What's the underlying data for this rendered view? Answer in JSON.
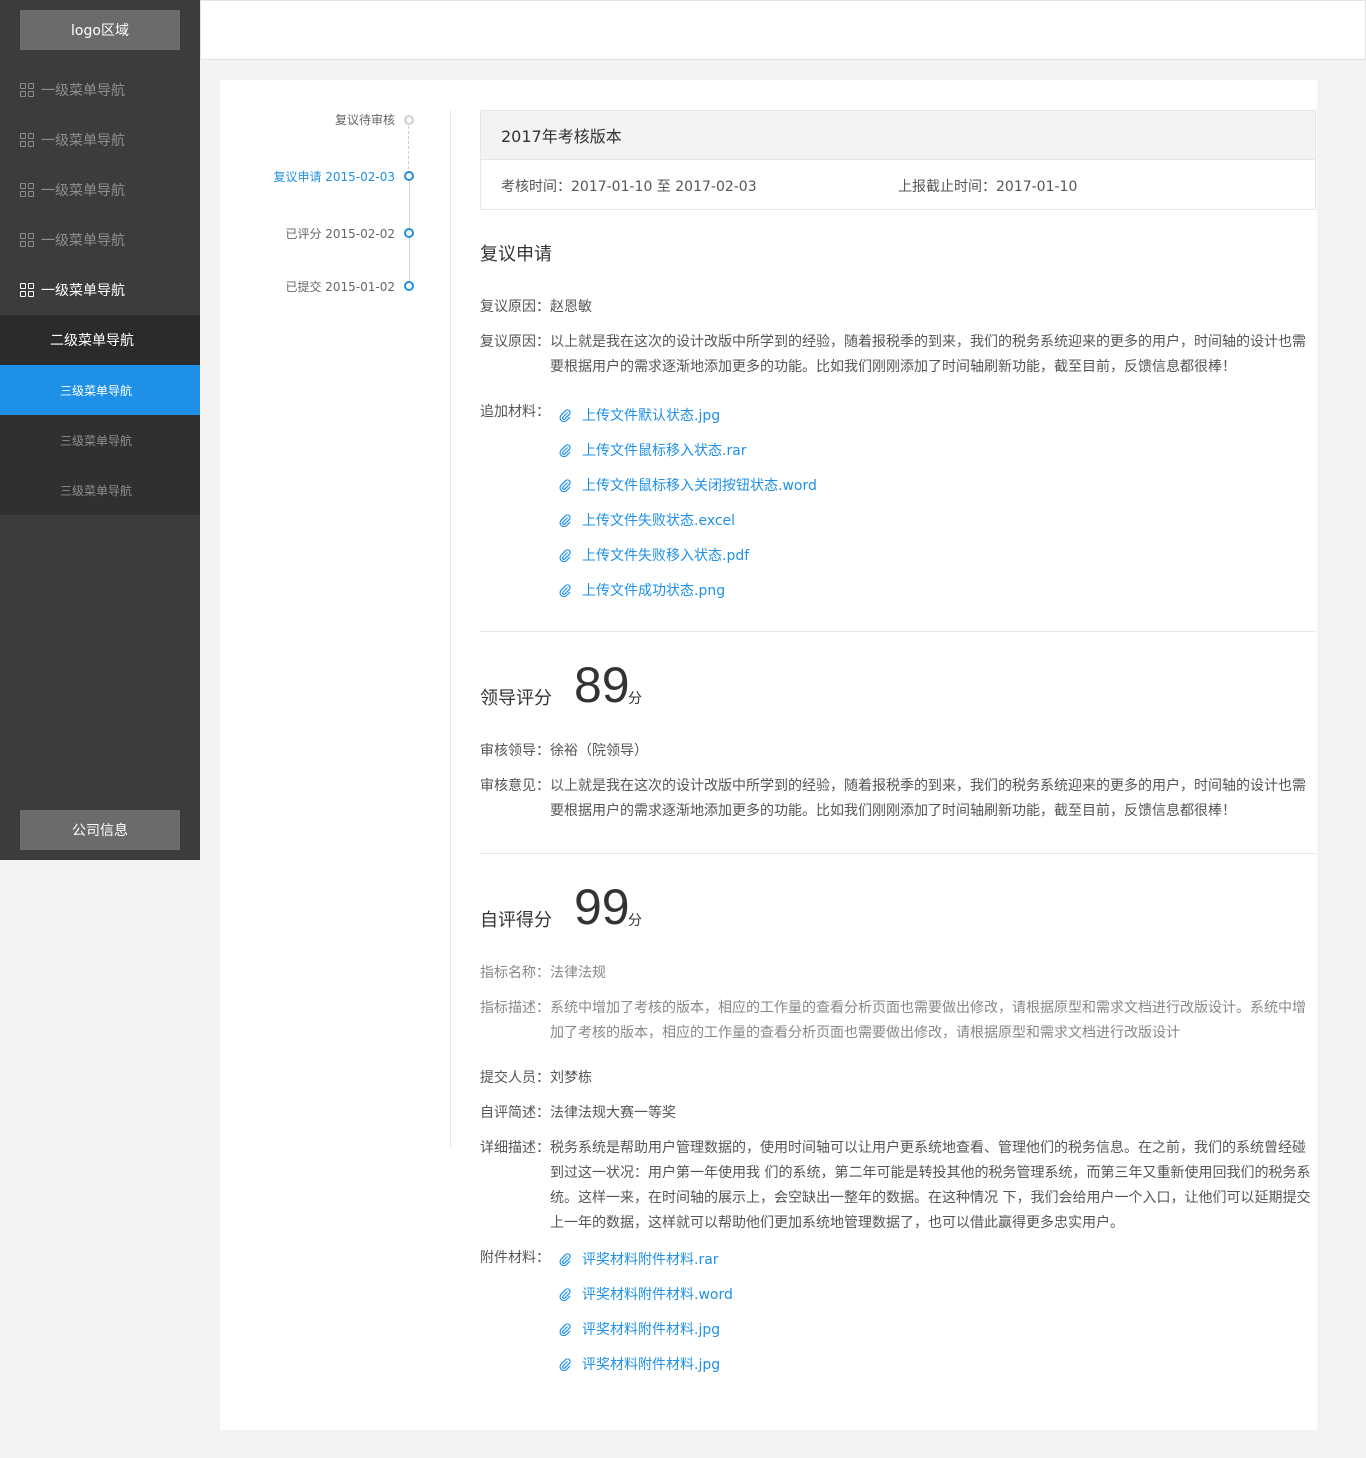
{
  "sidebar": {
    "logo": "logo区域",
    "level1": [
      "一级菜单导航",
      "一级菜单导航",
      "一级菜单导航",
      "一级菜单导航",
      "一级菜单导航"
    ],
    "level2": "二级菜单导航",
    "level3": [
      "三级菜单导航",
      "三级菜单导航",
      "三级菜单导航"
    ],
    "company": "公司信息"
  },
  "timeline": [
    {
      "text": "复议待审核",
      "state": "pending"
    },
    {
      "text": "复议申请 2015-02-03",
      "state": "current"
    },
    {
      "text": "已评分 2015-02-02",
      "state": "done"
    },
    {
      "text": "已提交 2015-01-02",
      "state": "done"
    }
  ],
  "card": {
    "title": "2017年考核版本",
    "period": "考核时间：2017-01-10 至 2017-02-03",
    "deadline": "上报截止时间：2017-01-10"
  },
  "review": {
    "title": "复议申请",
    "reason1_label": "复议原因：",
    "reason1_value": "赵恩敏",
    "reason2_label": "复议原因：",
    "reason2_value": "以上就是我在这次的设计改版中所学到的经验，随着报税季的到来，我们的税务系统迎来的更多的用户，时间轴的设计也需要根据用户的需求逐渐地添加更多的功能。比如我们刚刚添加了时间轴刷新功能，截至目前，反馈信息都很棒！",
    "materials_label": "追加材料：",
    "files": [
      "上传文件默认状态.jpg",
      "上传文件鼠标移入状态.rar",
      "上传文件鼠标移入关闭按钮状态.word",
      "上传文件失败状态.excel",
      "上传文件失败移入状态.pdf",
      "上传文件成功状态.png"
    ]
  },
  "leader": {
    "title": "领导评分",
    "score": "89",
    "unit": "分",
    "reviewer_label": "审核领导：",
    "reviewer_value": "徐裕（院领导）",
    "opinion_label": "审核意见：",
    "opinion_value": "以上就是我在这次的设计改版中所学到的经验，随着报税季的到来，我们的税务系统迎来的更多的用户，时间轴的设计也需要根据用户的需求逐渐地添加更多的功能。比如我们刚刚添加了时间轴刷新功能，截至目前，反馈信息都很棒！"
  },
  "self": {
    "title": "自评得分",
    "score": "99",
    "unit": "分",
    "index_name_label": "指标名称：",
    "index_name_value": "法律法规",
    "index_desc_label": "指标描述：",
    "index_desc_value": "系统中增加了考核的版本，相应的工作量的查看分析页面也需要做出修改，请根据原型和需求文档进行改版设计。系统中增加了考核的版本，相应的工作量的查看分析页面也需要做出修改，请根据原型和需求文档进行改版设计",
    "submitter_label": "提交人员：",
    "submitter_value": "刘梦栋",
    "summary_label": "自评简述：",
    "summary_value": "法律法规大赛一等奖",
    "detail_label": "详细描述：",
    "detail_value": "税务系统是帮助用户管理数据的，使用时间轴可以让用户更系统地查看、管理他们的税务信息。在之前，我们的系统曾经碰到过这一状况：用户第一年使用我 们的系统，第二年可能是转投其他的税务管理系统，而第三年又重新使用回我们的税务系统。这样一来，在时间轴的展示上，会空缺出一整年的数据。在这种情况 下，我们会给用户一个入口，让他们可以延期提交上一年的数据，这样就可以帮助他们更加系统地管理数据了，也可以借此赢得更多忠实用户。",
    "attach_label": "附件材料：",
    "files": [
      "评奖材料附件材料.rar",
      "评奖材料附件材料.word",
      "评奖材料附件材料.jpg",
      "评奖材料附件材料.jpg"
    ]
  },
  "colors": {
    "accent": "#1e90e8",
    "sidebar": "#3c3c3c"
  }
}
